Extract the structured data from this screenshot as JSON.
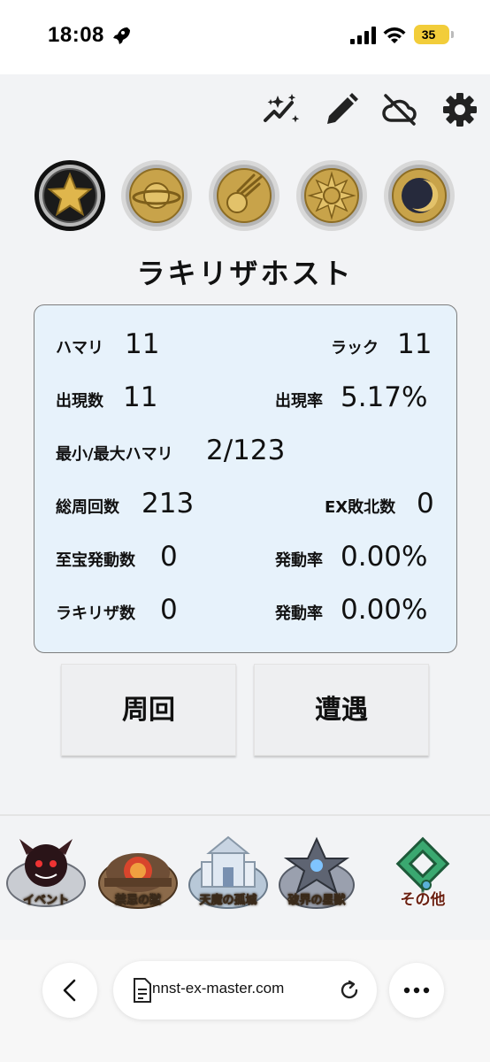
{
  "status_bar": {
    "time": "18:08",
    "battery": "35",
    "icons": [
      "rocket-icon",
      "signal-icon",
      "wifi-icon",
      "battery-icon"
    ]
  },
  "toolbar": {
    "icons": [
      "sparkle-chart-icon",
      "pencil-icon",
      "cloud-off-icon",
      "gear-icon"
    ]
  },
  "medals": [
    {
      "name": "star-medal",
      "selected": true
    },
    {
      "name": "planet-medal",
      "selected": false
    },
    {
      "name": "comet-medal",
      "selected": false
    },
    {
      "name": "sun-medal",
      "selected": false
    },
    {
      "name": "moon-medal",
      "selected": false
    }
  ],
  "monster_name": "ラキリザホスト",
  "stats": {
    "hamari_label": "ハマリ",
    "hamari_value": "11",
    "luck_label": "ラック",
    "luck_value": "11",
    "appear_count_label": "出現数",
    "appear_count_value": "11",
    "appear_rate_label": "出現率",
    "appear_rate_value": "5.17%",
    "minmax_label": "最小/最大ハマリ",
    "minmax_value": "2/123",
    "total_label": "総周回数",
    "total_value": "213",
    "ex_defeat_label": "EX敗北数",
    "ex_defeat_value": "0",
    "treasure_label": "至宝発動数",
    "treasure_value": "0",
    "treasure_rate_label": "発動率",
    "treasure_rate_value": "0.00%",
    "lakiriza_label": "ラキリザ数",
    "lakiriza_value": "0",
    "lakiriza_rate_label": "発動率",
    "lakiriza_rate_value": "0.00%"
  },
  "actions": {
    "lap_label": "周回",
    "encounter_label": "遭遇"
  },
  "tabs": [
    {
      "label": "イベント",
      "icon": "event-tab-icon"
    },
    {
      "label": "禁忌の獄",
      "icon": "forbidden-prison-tab-icon"
    },
    {
      "label": "天魔の孤城",
      "icon": "tenma-castle-tab-icon"
    },
    {
      "label": "破界の星獣",
      "icon": "hakai-star-beast-tab-icon"
    },
    {
      "label": "その他",
      "icon": "other-tab-icon"
    }
  ],
  "browser": {
    "url": "nnst-ex-master.com",
    "icons": [
      "back-icon",
      "page-icon",
      "reload-icon",
      "more-icon"
    ]
  },
  "colors": {
    "card_bg": "#e7f2fb",
    "app_bg": "#f2f3f5",
    "battery": "#f2cd3a",
    "medal_gold": "#c8a34a"
  }
}
